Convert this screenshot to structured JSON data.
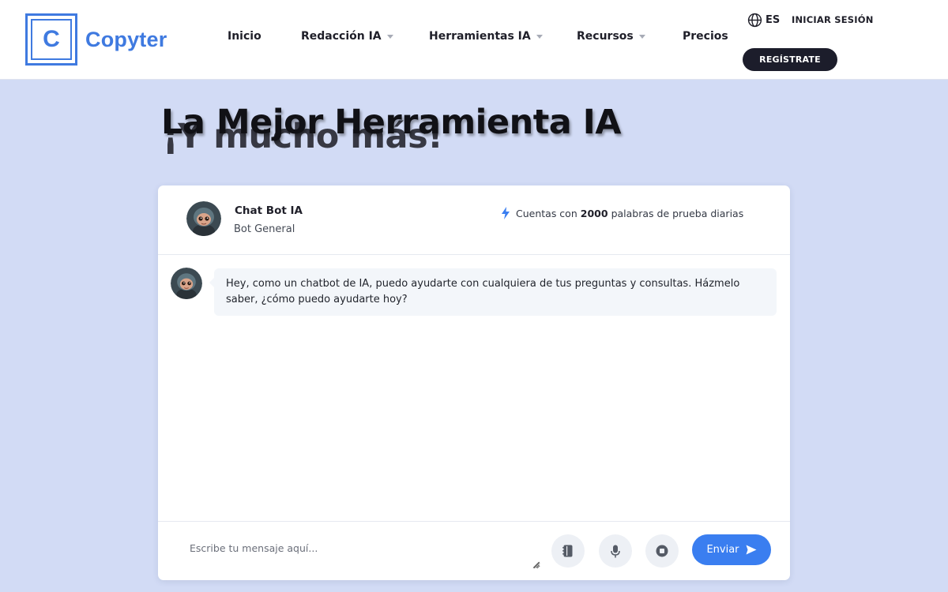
{
  "brand": {
    "logo_letter": "C",
    "name": "Copyter",
    "color": "#3f7ae0"
  },
  "nav": {
    "items": [
      {
        "label": "Inicio",
        "has_dropdown": false
      },
      {
        "label": "Redacción IA",
        "has_dropdown": true
      },
      {
        "label": "Herramientas IA",
        "has_dropdown": true
      },
      {
        "label": "Recursos",
        "has_dropdown": true
      },
      {
        "label": "Precios",
        "has_dropdown": false
      }
    ],
    "language": "ES",
    "login_label": "INICIAR SESIÓN",
    "register_label": "REGÍSTRATE"
  },
  "hero": {
    "title": "La Mejor Herramienta IA",
    "title_behind": "¡Y mucho más!"
  },
  "chat": {
    "bot_name": "Chat Bot IA",
    "bot_role": "Bot General",
    "trial": {
      "prefix": "Cuentas con",
      "words": "2000",
      "suffix": "palabras de prueba diarias"
    },
    "messages": [
      {
        "from": "bot",
        "text": "Hey, como un chatbot de IA, puedo ayudarte con cualquiera de tus preguntas y consultas. Házmelo saber, ¿cómo puedo ayudarte hoy?"
      }
    ],
    "input": {
      "placeholder": "Escribe tu mensaje aquí...",
      "value": ""
    },
    "send_label": "Enviar",
    "icons": [
      "prompt-book-icon",
      "microphone-icon",
      "stop-icon",
      "send-arrow-icon"
    ]
  },
  "colors": {
    "page_bg": "#d2dbf5",
    "accent": "#3a7ef0",
    "dark_button": "#1c1d2b",
    "bubble_bg": "#f3f6fa"
  }
}
